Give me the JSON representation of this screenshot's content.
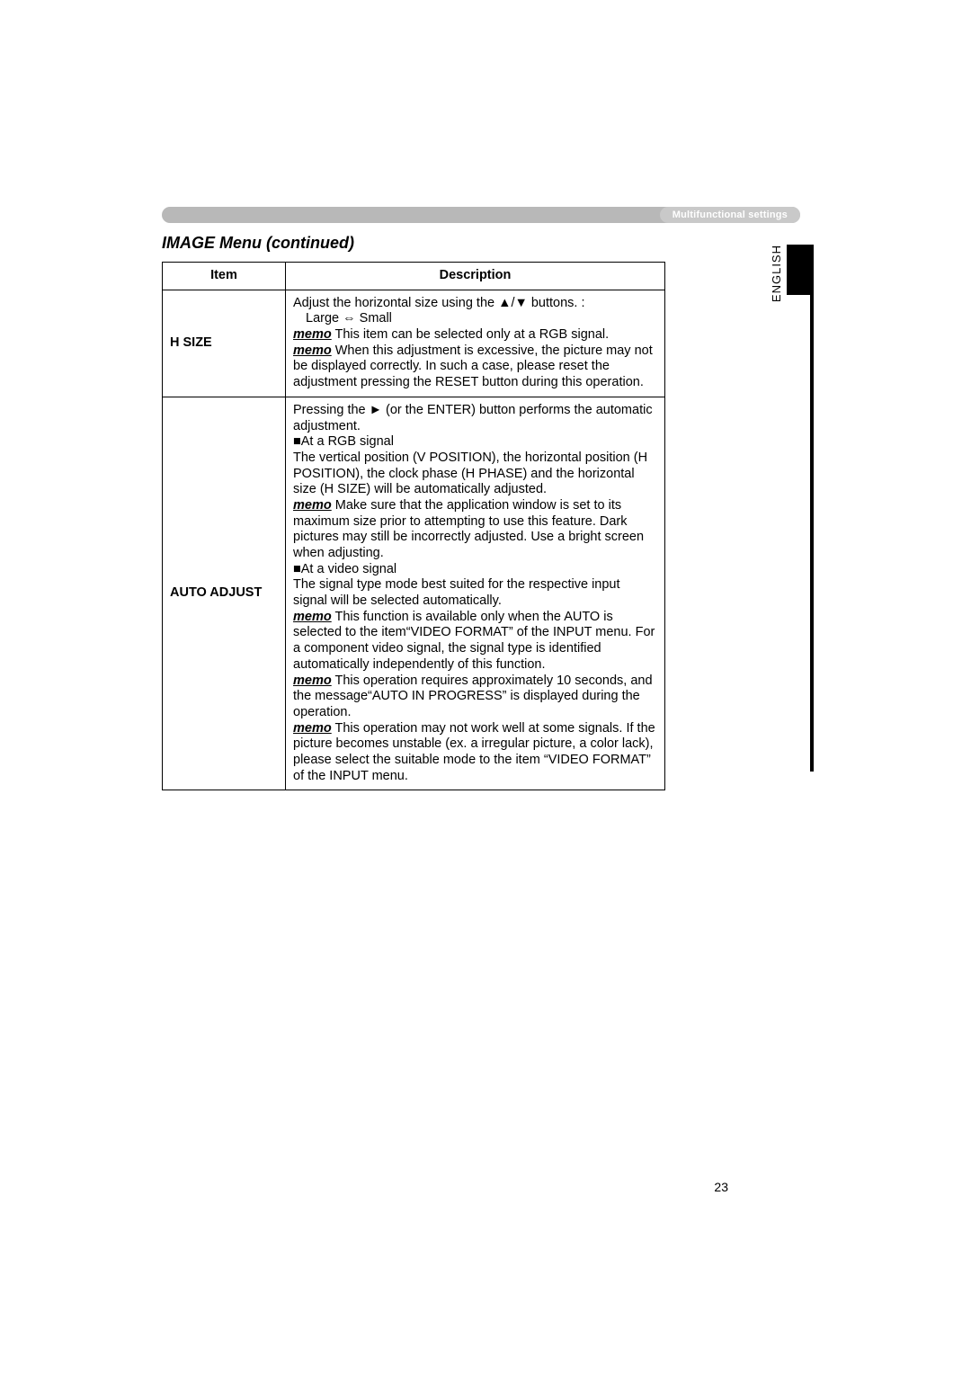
{
  "header": {
    "pill": "Multifunctional settings",
    "section_title": "IMAGE Menu (continued)"
  },
  "side": {
    "label": "ENGLISH"
  },
  "table": {
    "headers": {
      "item": "Item",
      "description": "Description"
    },
    "rows": [
      {
        "item": "H SIZE",
        "desc": {
          "l1": "Adjust the horizontal size using the ▲/▼ buttons. :",
          "l2": "Large ⇔ Small",
          "m1_label": "memo",
          "m1": " This item can be selected only at a RGB signal.",
          "m2_label": "memo",
          "m2": " When this adjustment is excessive, the picture may not be displayed correctly. In such a case, please reset the adjustment pressing the RESET button during this operation."
        }
      },
      {
        "item": "AUTO ADJUST",
        "desc": {
          "l1": "Pressing the ► (or the ENTER) button performs the automatic adjustment.",
          "h1": "■At a RGB signal",
          "p1": "The vertical position (V POSITION), the horizontal position (H POSITION), the clock phase (H PHASE) and the horizontal size (H SIZE) will be automatically adjusted.",
          "m1_label": "memo",
          "m1": " Make sure that the application window is set to its maximum size prior to attempting to use this feature. Dark pictures may still be incorrectly adjusted. Use a bright screen when adjusting.",
          "h2": "■At a video signal",
          "p2": "The signal type mode best suited for the respective input signal will be selected automatically.",
          "m2_label": "memo",
          "m2": " This function is available only when the AUTO is selected to the item“VIDEO FORMAT” of the INPUT menu. For a component video signal, the signal type is identified automatically independently of this function.",
          "m3_label": "memo",
          "m3": " This operation requires approximately 10 seconds, and the message“AUTO IN PROGRESS” is displayed during the operation.",
          "m4_label": "memo",
          "m4": " This operation may not work well at some signals. If the picture becomes unstable (ex. a irregular picture, a color lack), please select the suitable mode to the item “VIDEO FORMAT” of the INPUT menu."
        }
      }
    ]
  },
  "page_number": "23"
}
